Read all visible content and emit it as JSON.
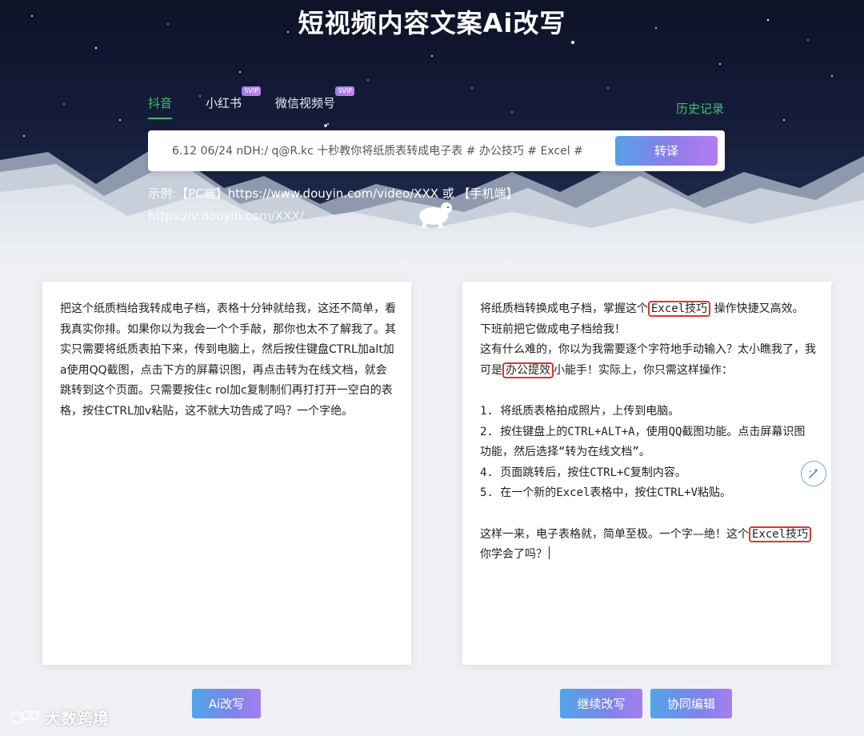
{
  "header": {
    "title": "短视频内容文案Ai改写",
    "tabs": [
      {
        "label": "抖音",
        "active": true,
        "badge": ""
      },
      {
        "label": "小红书",
        "active": false,
        "badge": "SVIP"
      },
      {
        "label": "微信视频号",
        "active": false,
        "badge": "SVIP"
      }
    ],
    "history_label": "历史记录"
  },
  "search": {
    "value": "6.12 06/24 nDH:/ q@R.kc 十秒教你将纸质表转成电子表 # 办公技巧 # Excel #",
    "button_label": "转译"
  },
  "example": {
    "prefix": "示例:",
    "text": "【PC端】https://www.douyin.com/video/XXX 或 【手机端】",
    "url2": "https://v.douyin.com/XXX/"
  },
  "left_panel": {
    "text": "把这个纸质档给我转成电子档，表格十分钟就给我，这还不简单，看我真实你排。如果你以为我会一个个手敲，那你也太不了解我了。其实只需要将纸质表拍下来，传到电脑上，然后按住键盘CTRL加alt加a使用QQ截图，点击下方的屏幕识图，再点击转为在线文档，就会跳转到这个页面。只需要按住c rol加c复制制们再打打开一空白的表格，按住CTRL加v粘贴，这不就大功告成了吗？一个字绝。",
    "button_label": "Ai改写"
  },
  "right_panel": {
    "line1_a": "将纸质档转换成电子档，掌握这个",
    "line1_hl": "Excel技巧",
    "line1_b": " 操作快捷又高效。",
    "line2": "下班前把它做成电子档给我！",
    "line3_a": "这有什么难的，你以为我需要逐个字符地手动输入？太小瞧我了，我可是",
    "line3_hl": "办公提效",
    "line3_b": "小能手！实际上，你只需这样操作：",
    "steps": [
      "1. 将纸质表格拍成照片，上传到电脑。",
      "2. 按住键盘上的CTRL+ALT+A，使用QQ截图功能。点击屏幕识图功能，然后选择“转为在线文档”。",
      "4. 页面跳转后，按住CTRL+C复制内容。",
      "5. 在一个新的Excel表格中，按住CTRL+V粘贴。"
    ],
    "end_a": "这样一来，电子表格就，简单至极。一个字—绝！这个",
    "end_hl": "Excel技巧",
    "end_b": "你学会了吗？",
    "continue_label": "继续改写",
    "collab_label": "协同编辑"
  },
  "watermark": {
    "text": "大数跨境"
  },
  "colors": {
    "accent_green": "#3cc46a",
    "highlight_red": "#d8382b",
    "button_gradient_start": "#4fa6e6",
    "button_gradient_end": "#a67ef0"
  }
}
